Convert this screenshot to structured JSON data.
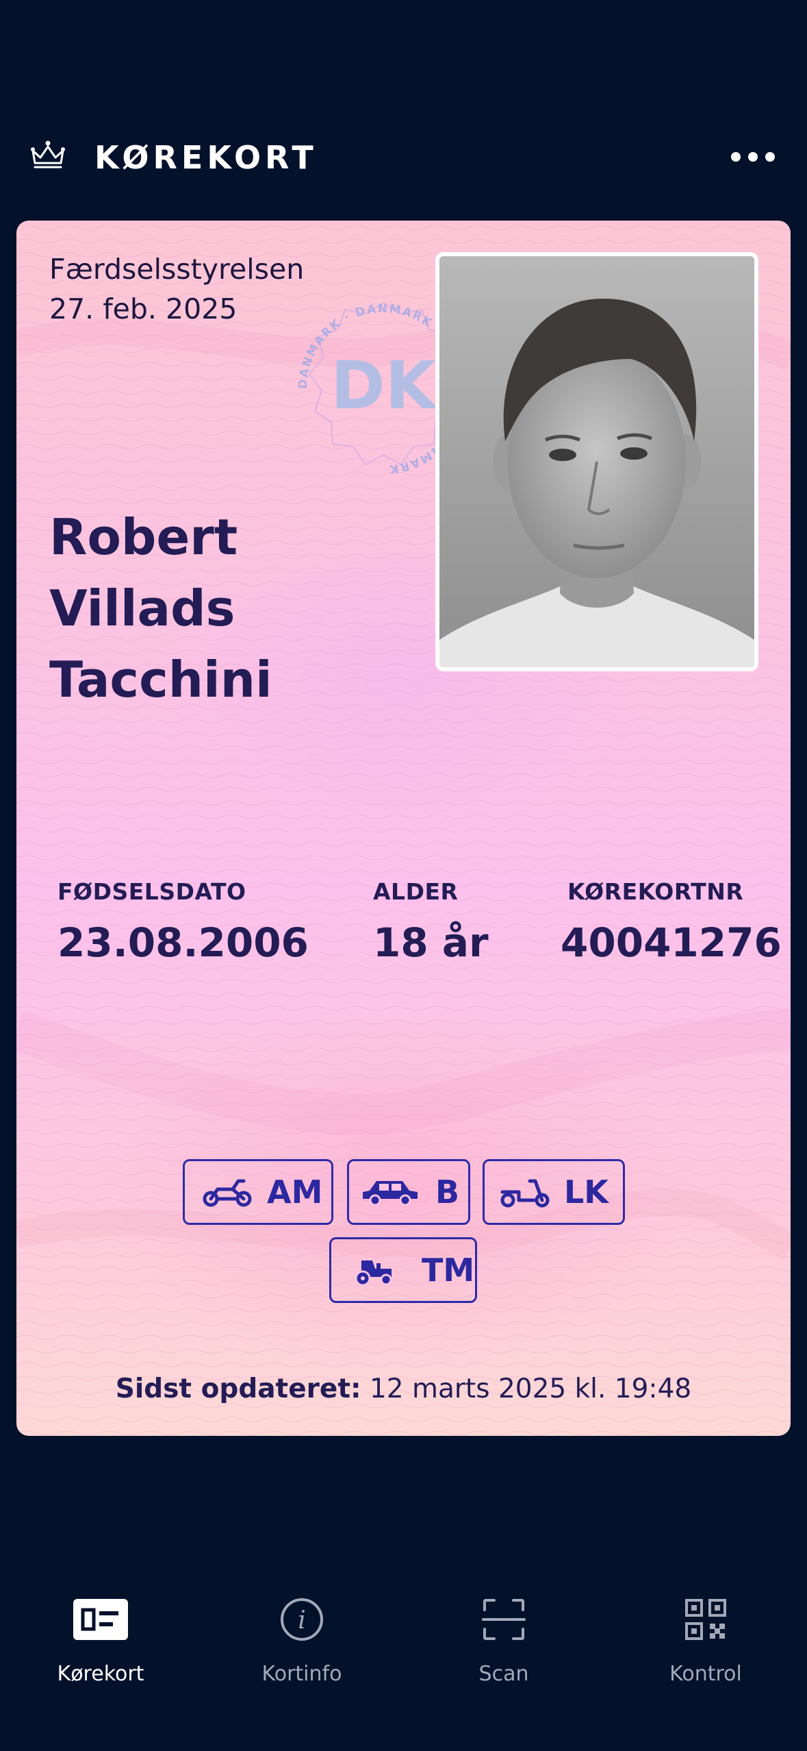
{
  "header": {
    "title": "KØREKORT",
    "icons": {
      "logo": "crown-icon",
      "menu": "more-dots-icon"
    }
  },
  "card": {
    "issuer": "Færdselsstyrelsen",
    "issue_date": "27. feb. 2025",
    "name_line1": "Robert Villads",
    "name_line2": "Tacchini",
    "seal": {
      "center": "DK",
      "ring_text": "DANMARK"
    },
    "fields": [
      {
        "label": "FØDSELSDATO",
        "value": "23.08.2006"
      },
      {
        "label": "ALDER",
        "value": "18 år"
      },
      {
        "label": "KØREKORTNR",
        "value": "40041276"
      }
    ],
    "categories": [
      {
        "code": "AM",
        "icon": "moped-icon"
      },
      {
        "code": "B",
        "icon": "car-icon"
      },
      {
        "code": "LK",
        "icon": "scooter-icon"
      },
      {
        "code": "TM",
        "icon": "tractor-icon"
      }
    ],
    "updated_label": "Sidst opdateret:",
    "updated_value": "12 marts 2025 kl. 19:48"
  },
  "nav": [
    {
      "label": "Kørekort",
      "icon": "id-card-icon",
      "active": true
    },
    {
      "label": "Kortinfo",
      "icon": "info-icon",
      "active": false
    },
    {
      "label": "Scan",
      "icon": "scan-icon",
      "active": false
    },
    {
      "label": "Kontrol",
      "icon": "qr-code-icon",
      "active": false
    }
  ],
  "colors": {
    "background": "#03112b",
    "card_pink": "#fcc3e2",
    "text_dark": "#231c55",
    "category_blue": "#2c28a0",
    "nav_inactive": "#a3a9b8"
  }
}
